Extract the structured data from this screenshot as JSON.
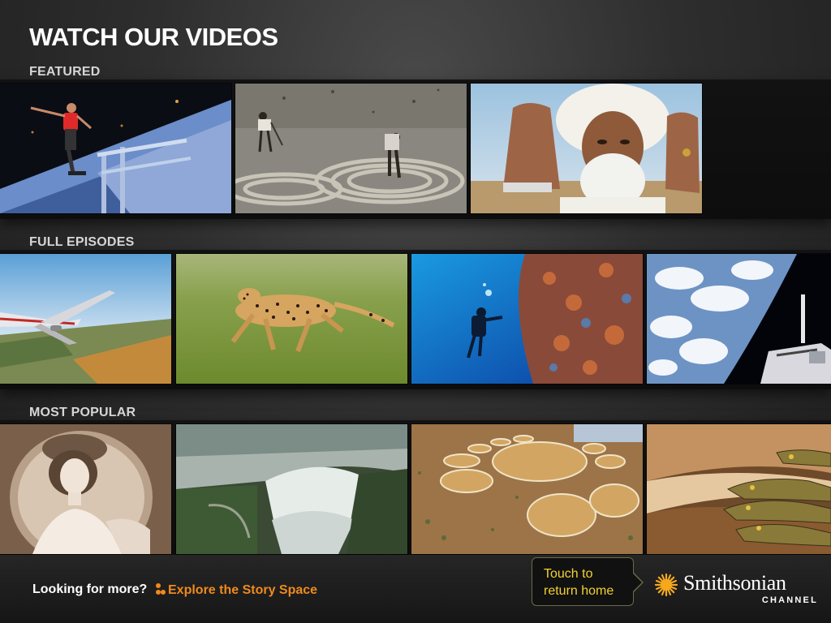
{
  "page": {
    "title": "WATCH OUR VIDEOS"
  },
  "sections": [
    {
      "label": "FEATURED",
      "videos": [
        {
          "scene": "skateboarder grinding rail at night"
        },
        {
          "scene": "people raking spiral patterns in desert sand"
        },
        {
          "scene": "bearded man in white turban praying"
        }
      ]
    },
    {
      "label": "FULL EPISODES",
      "videos": [
        {
          "scene": "airliner flying over countryside"
        },
        {
          "scene": "cheetah running through grass"
        },
        {
          "scene": "scuba diver beside coral wall"
        },
        {
          "scene": "space shuttle above Earth"
        }
      ]
    },
    {
      "label": "MOST POPULAR",
      "videos": [
        {
          "scene": "vintage sepia portrait of a woman"
        },
        {
          "scene": "aerial view of a waterfall"
        },
        {
          "scene": "circular fields in arid landscape"
        },
        {
          "scene": "baby crocodiles on a log"
        }
      ]
    }
  ],
  "footer": {
    "more_text": "Looking for more?",
    "explore_link": "Explore the Story Space",
    "home_button": "Touch to return home",
    "logo_name": "Smithsonian",
    "logo_channel": "CHANNEL"
  },
  "colors": {
    "accent_orange": "#f08a1c",
    "home_yellow": "#f2d232",
    "logo_sun": "#f6a81c"
  },
  "icons": [
    "story-space-icon",
    "sun-logo-icon",
    "arrow-right-icon"
  ]
}
